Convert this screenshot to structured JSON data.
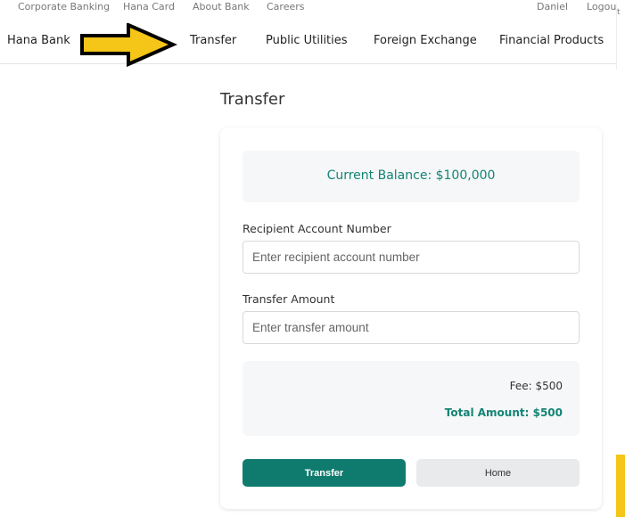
{
  "topbar": {
    "left_links": [
      "Corporate Banking",
      "Hana Card",
      "About Bank",
      "Careers"
    ],
    "user": "Daniel",
    "logout": "Logout",
    "side_clip": "t"
  },
  "nav": {
    "brand": "Hana Bank",
    "links": [
      "Transfer",
      "Public Utilities",
      "Foreign Exchange",
      "Financial Products"
    ]
  },
  "page": {
    "title": "Transfer"
  },
  "balance": {
    "text": "Current Balance: $100,000"
  },
  "form": {
    "recipient_label": "Recipient Account Number",
    "recipient_placeholder": "Enter recipient account number",
    "amount_label": "Transfer Amount",
    "amount_placeholder": "Enter transfer amount"
  },
  "summary": {
    "fee": "Fee: $500",
    "total": "Total Amount: $500"
  },
  "buttons": {
    "transfer": "Transfer",
    "home": "Home"
  },
  "colors": {
    "accent": "#128476",
    "primary_button": "#0f7b6f",
    "highlight": "#f5c518"
  }
}
